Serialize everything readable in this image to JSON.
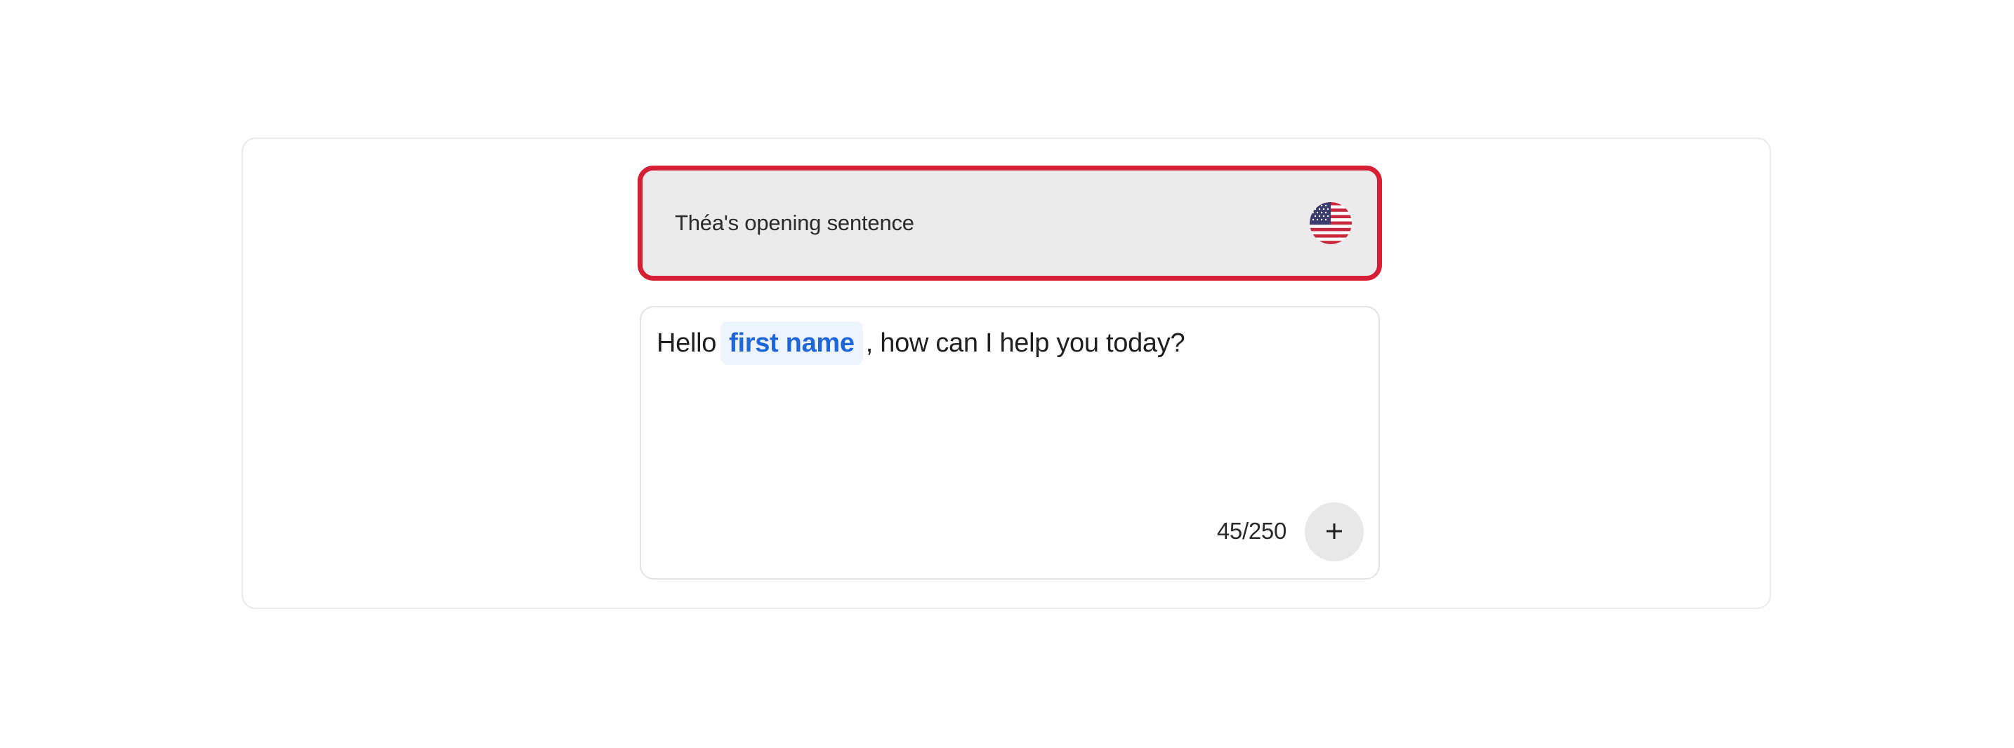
{
  "header": {
    "label": "Théa's opening sentence",
    "language_icon": "us-flag-icon"
  },
  "message": {
    "prefix": "Hello",
    "variable": "first name",
    "suffix": ", how can I help you today?",
    "counter": "45/250",
    "add_icon": "plus-icon"
  },
  "colors": {
    "highlight_border": "#d61f34",
    "variable_text": "#1f66d8",
    "variable_bg": "#eef4fd"
  }
}
